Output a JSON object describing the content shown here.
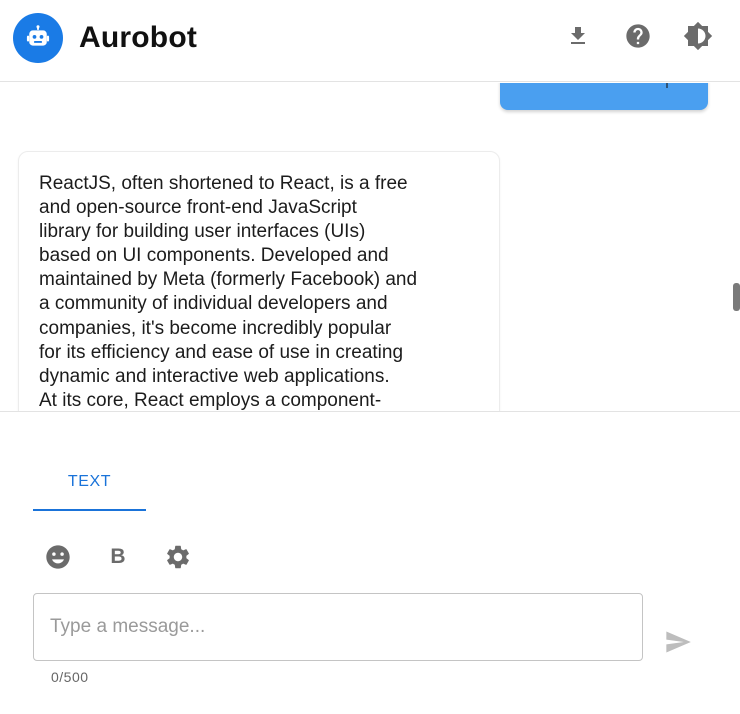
{
  "header": {
    "title": "Aurobot",
    "logo_icon": "robot-icon",
    "actions": [
      {
        "name": "download",
        "icon": "download-icon"
      },
      {
        "name": "help",
        "icon": "help-circle-icon"
      },
      {
        "name": "theme",
        "icon": "brightness-icon"
      }
    ]
  },
  "colors": {
    "brand": "#1a7be6",
    "user_bubble": "#4a9ff0",
    "tab_active": "#1a73d9",
    "icon_gray": "#6b6b6b"
  },
  "messages": [
    {
      "role": "user",
      "text": ""
    },
    {
      "role": "bot",
      "text": "ReactJS, often shortened to React, is a free\nand open-source front-end JavaScript\nlibrary for building user interfaces (UIs)\nbased on UI components. Developed and\nmaintained by Meta (formerly Facebook) and\na community of individual developers and\ncompanies, it's become incredibly popular\nfor its efficiency and ease of use in creating\ndynamic and interactive web applications.\nAt its core, React employs a component-"
    }
  ],
  "composer": {
    "tabs": [
      {
        "label": "TEXT",
        "active": true
      }
    ],
    "toolbar": [
      {
        "name": "emoji",
        "icon": "emoji-icon"
      },
      {
        "name": "bold",
        "label": "B"
      },
      {
        "name": "settings",
        "icon": "gear-icon"
      }
    ],
    "placeholder": "Type a message...",
    "value": "",
    "char_count": "0/500",
    "send_icon": "send-icon"
  }
}
